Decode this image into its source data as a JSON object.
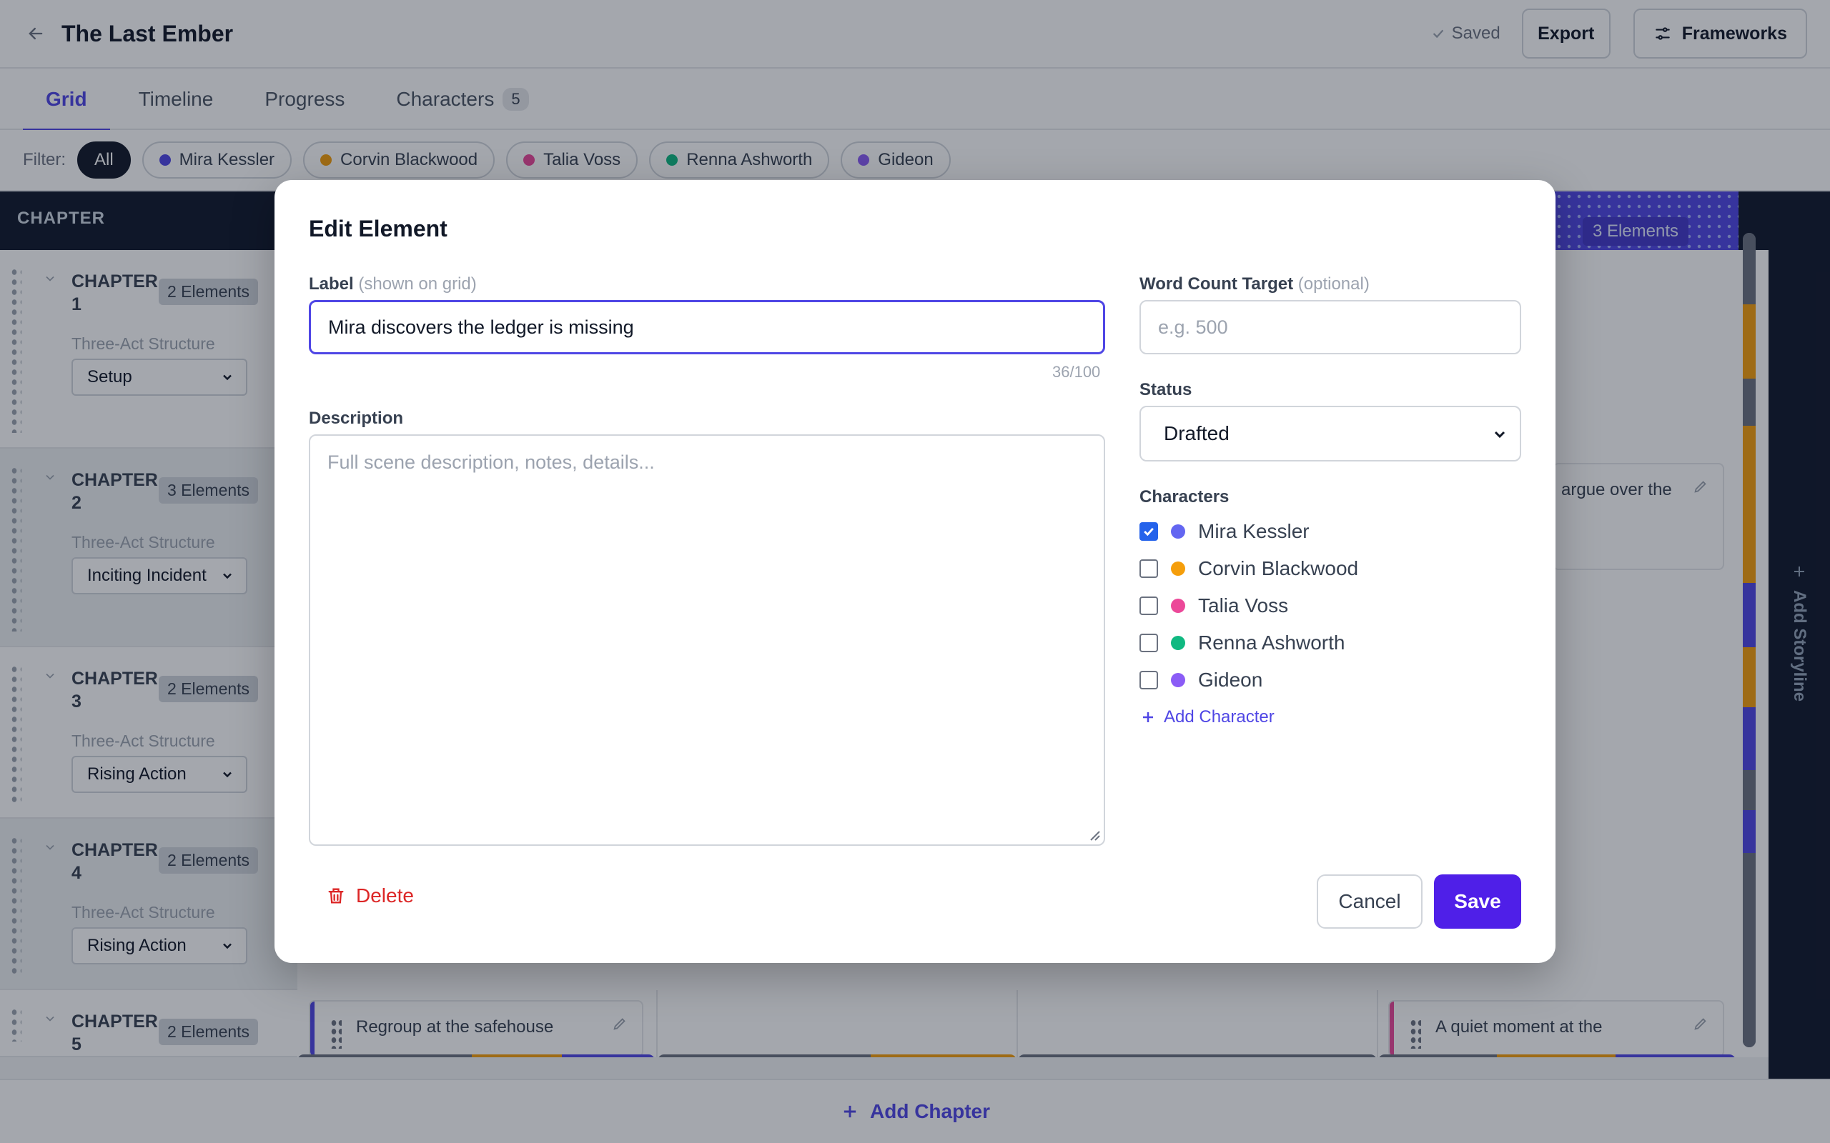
{
  "header": {
    "title": "The Last Ember",
    "saved_label": "Saved",
    "export_label": "Export",
    "frameworks_label": "Frameworks"
  },
  "tabs": [
    {
      "label": "Grid",
      "active": true
    },
    {
      "label": "Timeline"
    },
    {
      "label": "Progress"
    },
    {
      "label": "Characters",
      "count": "5"
    }
  ],
  "filter": {
    "label": "Filter:",
    "chips": [
      {
        "label": "All",
        "active": true
      },
      {
        "label": "Mira Kessler",
        "color": "#4f46e5"
      },
      {
        "label": "Corvin Blackwood",
        "color": "#f59e0b"
      },
      {
        "label": "Talia Voss",
        "color": "#ec4899"
      },
      {
        "label": "Renna Ashworth",
        "color": "#10b981"
      },
      {
        "label": "Gideon",
        "color": "#8b5cf6"
      }
    ]
  },
  "grid": {
    "chapter_header": "CHAPTER",
    "storyline_badge": "3 Elements",
    "structure_label": "Three-Act Structure",
    "chapters": [
      {
        "title": "CHAPTER\n1",
        "badge": "2 Elements",
        "act": "Setup"
      },
      {
        "title": "CHAPTER\n2",
        "badge": "3 Elements",
        "act": "Inciting Incident"
      },
      {
        "title": "CHAPTER\n3",
        "badge": "2 Elements",
        "act": "Rising Action"
      },
      {
        "title": "CHAPTER\n4",
        "badge": "2 Elements",
        "act": "Rising Action"
      },
      {
        "title": "CHAPTER\n5",
        "badge": "2 Elements"
      }
    ],
    "cards": {
      "argue": "argue over the",
      "regroup": "Regroup at the safehouse",
      "quiet": "A quiet moment at the"
    },
    "add_storyline": "Add Storyline",
    "add_chapter": "Add Chapter"
  },
  "modal": {
    "title": "Edit Element",
    "label_field": {
      "label": "Label",
      "hint": "(shown on grid)",
      "value": "Mira discovers the ledger is missing",
      "counter": "36/100"
    },
    "description": {
      "label": "Description",
      "placeholder": "Full scene description, notes, details..."
    },
    "word_count": {
      "label": "Word Count Target",
      "hint": "(optional)",
      "placeholder": "e.g. 500"
    },
    "status": {
      "label": "Status",
      "value": "Drafted"
    },
    "characters": {
      "label": "Characters",
      "items": [
        {
          "name": "Mira Kessler",
          "color": "#6366f1",
          "checked": true
        },
        {
          "name": "Corvin Blackwood",
          "color": "#f59e0b",
          "checked": false
        },
        {
          "name": "Talia Voss",
          "color": "#ec4899",
          "checked": false
        },
        {
          "name": "Renna Ashworth",
          "color": "#10b981",
          "checked": false
        },
        {
          "name": "Gideon",
          "color": "#8b5cf6",
          "checked": false
        }
      ],
      "add_label": "Add Character"
    },
    "delete_label": "Delete",
    "cancel_label": "Cancel",
    "save_label": "Save"
  }
}
